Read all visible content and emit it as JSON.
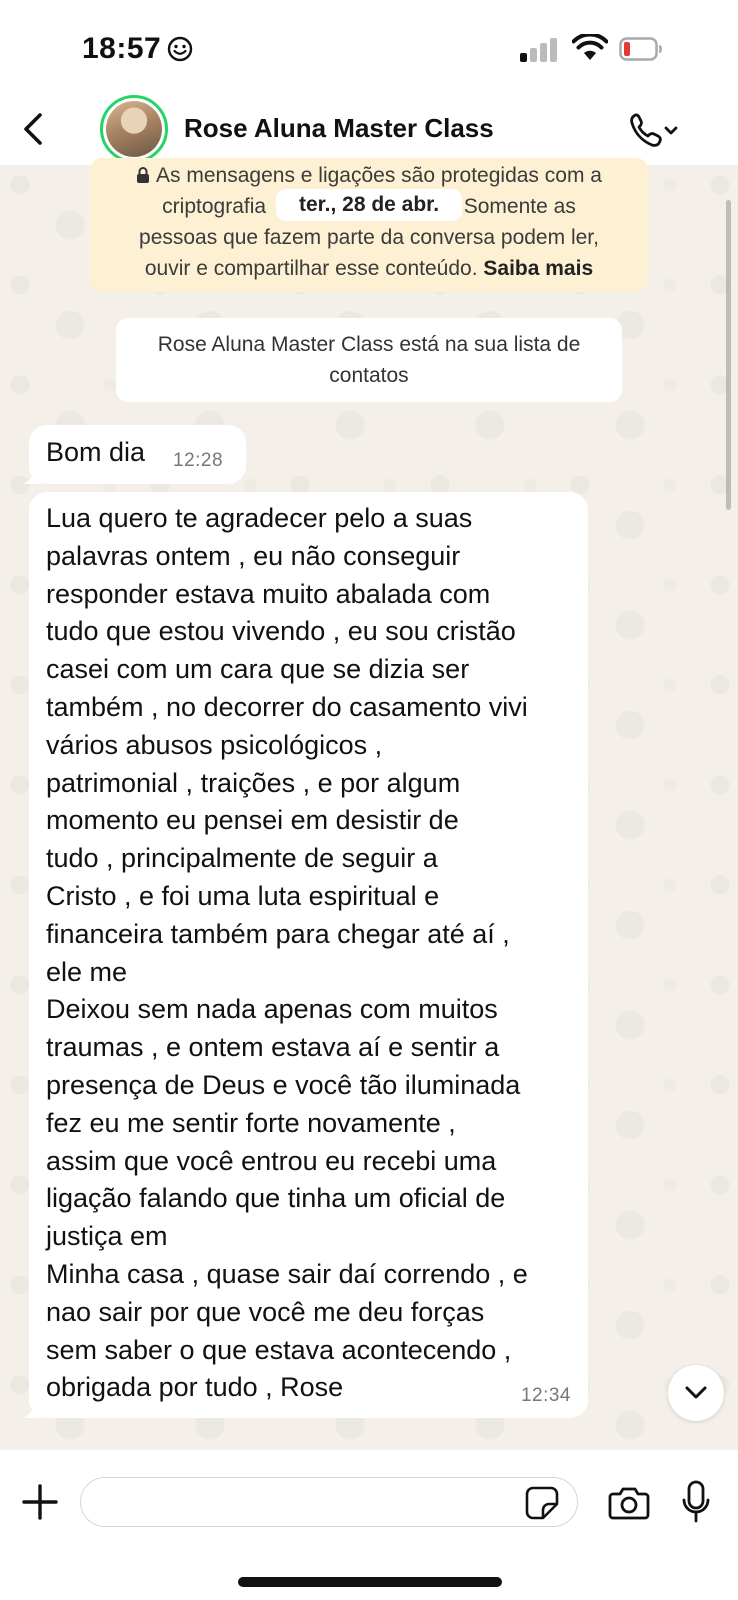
{
  "status_bar": {
    "time": "18:57"
  },
  "header": {
    "contact_name": "Rose Aluna Master Class"
  },
  "system": {
    "encryption_line1": "As mensagens e ligações são protegidas com a",
    "encryption_line2": "criptografia",
    "encryption_line2b": "Somente as",
    "encryption_line3": "pessoas que fazem parte da conversa podem ler,",
    "encryption_line4": "ouvir e compartilhar esse conteúdo.",
    "learn_more": "Saiba mais",
    "date_chip": "ter., 28 de abr.",
    "contact_notice": "Rose Aluna Master Class está na sua lista de contatos"
  },
  "messages": [
    {
      "text": "Bom dia",
      "time": "12:28"
    },
    {
      "text": "Lua quero te agradecer pelo a suas\npalavras ontem , eu não conseguir\nresponder estava muito abalada com\ntudo que estou vivendo , eu sou cristão\ncasei com um cara que se dizia ser\ntambém , no decorrer do casamento vivi\nvários abusos psicológicos ,\npatrimonial , traições , e por algum\nmomento eu pensei em desistir de\ntudo , principalmente de seguir a\nCristo , e foi uma luta espiritual e\nfinanceira também para chegar até aí ,\nele me\nDeixou sem nada apenas com muitos\ntraumas , e ontem estava aí e sentir a\npresença de Deus e você tão iluminada\nfez eu me sentir forte novamente ,\nassim que você entrou eu recebi uma\nligação falando que tinha um oficial de\njustiça em\nMinha casa , quase sair daí correndo , e\nnao sair por que você me deu forças\nsem saber o que estava acontecendo ,\nobrigada por tudo , Rose",
      "time": "12:34"
    }
  ],
  "composer": {
    "placeholder": ""
  },
  "colors": {
    "avatar_ring": "#25d366",
    "encryption_bg": "#fdf0d3",
    "wallpaper": "#f4f0e9",
    "battery_low": "#e53935"
  },
  "icons": [
    "smiley-icon",
    "signal-icon",
    "wifi-icon",
    "battery-icon",
    "back-icon",
    "phone-icon",
    "chevron-down-icon",
    "lock-icon",
    "plus-icon",
    "sticker-icon",
    "camera-icon",
    "microphone-icon"
  ]
}
